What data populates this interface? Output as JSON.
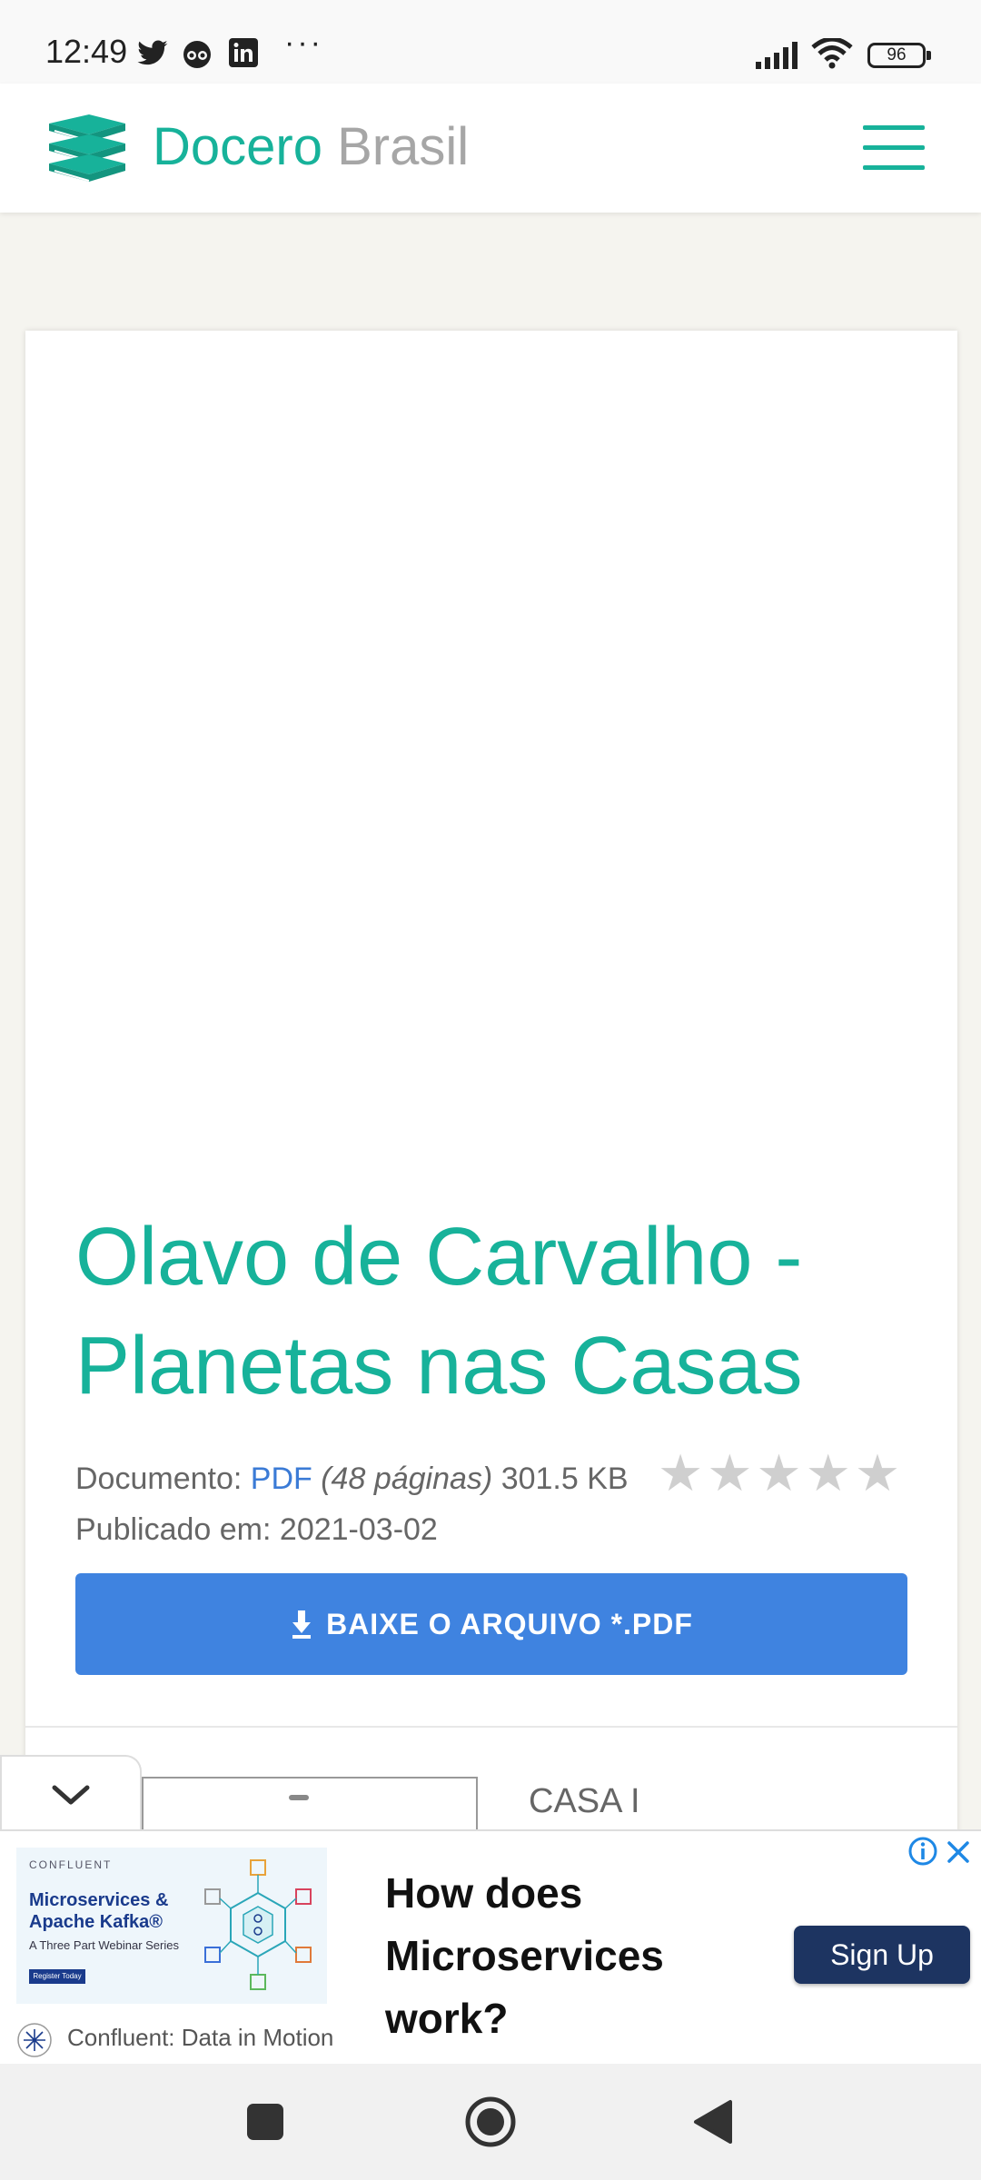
{
  "status_bar": {
    "time": "12:49",
    "battery": "96",
    "icons": [
      "twitter-icon",
      "app-icon",
      "linkedin-icon",
      "more-dots-icon",
      "signal-icon",
      "wifi-icon",
      "battery-icon"
    ]
  },
  "header": {
    "logo_primary": "Docero",
    "logo_secondary": "Brasil",
    "menu_icon": "hamburger-menu-icon"
  },
  "document": {
    "title": "Olavo de Carvalho - Planetas nas Casas",
    "type_label": "Documento:",
    "type_value": "PDF",
    "pages": "(48 páginas)",
    "size": "301.5 KB",
    "rating_stars": 5,
    "rating_value": 0,
    "published_label": "Publicado em:",
    "published_date": "2021-03-02",
    "download_label": "BAIXE O ARQUIVO *.PDF",
    "preview_text": "CASA I"
  },
  "ad": {
    "image_brand": "CONFLUENT",
    "image_title_line1": "Microservices &",
    "image_title_line2": "Apache Kafka®",
    "image_subtitle": "A Three Part Webinar Series",
    "image_cta": "Register Today",
    "headline": "How does Microservices work?",
    "cta": "Sign Up",
    "advertiser": "Confluent: Data in Motion"
  },
  "colors": {
    "brand_green": "#17b29a",
    "brand_gray": "#a6a6a6",
    "download_blue": "#3f83e0",
    "ad_button": "#1d3461"
  }
}
